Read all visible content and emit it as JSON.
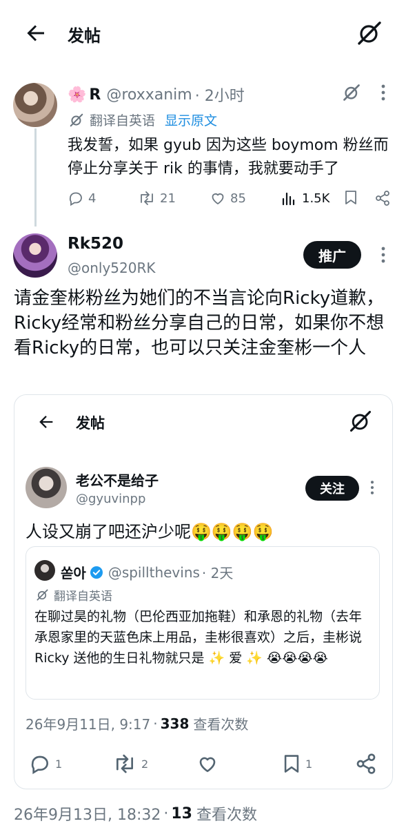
{
  "header": {
    "title": "发帖",
    "back_icon": "arrow-left-icon",
    "grok_icon": "grok-icon"
  },
  "reply_tweet": {
    "name_emoji": "🌸",
    "name": "R",
    "handle": "@roxxanim",
    "time": "· 2小时",
    "translated_label": "翻译自英语",
    "show_original": "显示原文",
    "body": "我发誓，如果 gyub 因为这些 boymom 粉丝而停止分享关于 rik 的事情，我就要动手了",
    "stats": {
      "replies": "4",
      "retweets": "21",
      "likes": "85",
      "views": "1.5K"
    }
  },
  "main_tweet": {
    "name": "Rk520",
    "handle": "@only520RK",
    "promo_label": "推广",
    "body": "请金奎彬粉丝为她们的不当言论向Ricky道歉，Ricky经常和粉丝分享自己的日常，如果你不想看Ricky的日常，也可以只关注金奎彬一个人",
    "embedded": {
      "title": "发帖",
      "name": "老公不是给子",
      "handle": "@gyuvinpp",
      "follow_label": "关注",
      "body": "人设又崩了吧还沪少呢🤑🤑🤑🤑",
      "quote": {
        "name": "쏟아",
        "handle": "@spillthevins",
        "time": "· 2天",
        "translated_label": "翻译自英语",
        "body": "在聊过昊的礼物（巴伦西亚加拖鞋）和承恩的礼物（去年承恩家里的天蓝色床上用品，圭彬很喜欢）之后，圭彬说 Ricky 送他的生日礼物就只是 ✨ 爱 ✨ 😭😭😭😭"
      },
      "meta_date": "26年9月11日, 9:17",
      "meta_views": "338",
      "meta_views_label": "查看次数",
      "stats": {
        "replies": "1",
        "retweets": "2",
        "bookmarks": "1"
      }
    },
    "meta_date": "26年9月13日, 18:32",
    "meta_views": "13",
    "meta_views_label": "查看次数"
  },
  "colors": {
    "accent": "#1d8de0",
    "button_bg": "#0f1419",
    "secondary_text": "#6b7680",
    "border": "#dfe5ea",
    "verified": "#1d9bf0"
  }
}
